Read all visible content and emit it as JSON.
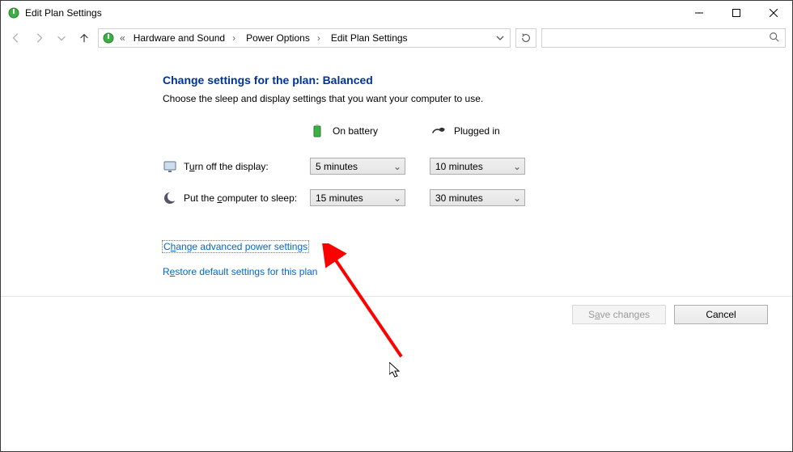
{
  "window": {
    "title": "Edit Plan Settings"
  },
  "breadcrumb": {
    "prefix": "«",
    "segments": [
      "Hardware and Sound",
      "Power Options",
      "Edit Plan Settings"
    ]
  },
  "page": {
    "title": "Change settings for the plan: Balanced",
    "subtitle": "Choose the sleep and display settings that you want your computer to use."
  },
  "columns": {
    "battery": "On battery",
    "plugged": "Plugged in"
  },
  "settings": {
    "display": {
      "label_pre": "T",
      "label_hot": "u",
      "label_post": "rn off the display:",
      "battery": "5 minutes",
      "plugged": "10 minutes"
    },
    "sleep": {
      "label_pre": "Put the ",
      "label_hot": "c",
      "label_post": "omputer to sleep:",
      "battery": "15 minutes",
      "plugged": "30 minutes"
    }
  },
  "links": {
    "advanced_pre": "C",
    "advanced_hot": "h",
    "advanced_post": "ange advanced power settings",
    "restore_pre": "R",
    "restore_hot": "e",
    "restore_post": "store default settings for this plan"
  },
  "buttons": {
    "save_pre": "S",
    "save_hot": "a",
    "save_post": "ve changes",
    "cancel": "Cancel"
  }
}
